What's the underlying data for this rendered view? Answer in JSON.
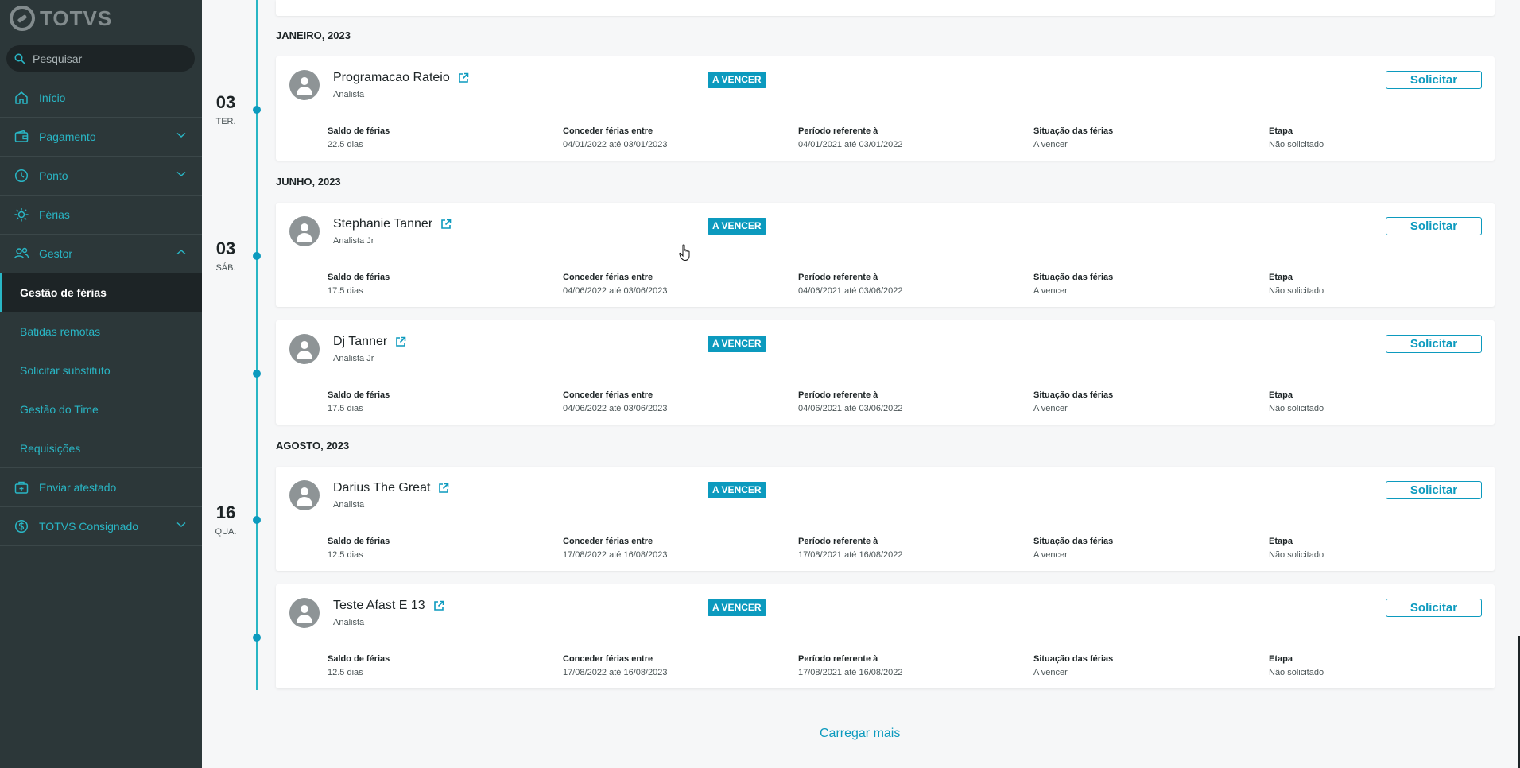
{
  "app": {
    "logo_text": "TOTVS"
  },
  "search": {
    "placeholder": "Pesquisar"
  },
  "sidebar": {
    "items": [
      {
        "label": "Início",
        "icon": "home-icon"
      },
      {
        "label": "Pagamento",
        "icon": "wallet-icon",
        "chevron": "down"
      },
      {
        "label": "Ponto",
        "icon": "clock-icon",
        "chevron": "down"
      },
      {
        "label": "Férias",
        "icon": "sun-icon"
      },
      {
        "label": "Gestor",
        "icon": "users-icon",
        "chevron": "up"
      },
      {
        "label": "Gestão de férias",
        "sub": true,
        "active": true
      },
      {
        "label": "Batidas remotas",
        "sub": true
      },
      {
        "label": "Solicitar substituto",
        "sub": true
      },
      {
        "label": "Gestão do Time",
        "sub": true
      },
      {
        "label": "Requisições",
        "sub": true
      },
      {
        "label": "Enviar atestado",
        "icon": "medical-bag-icon"
      },
      {
        "label": "TOTVS Consignado",
        "icon": "dollar-icon",
        "chevron": "down"
      }
    ]
  },
  "field_labels": {
    "saldo": "Saldo de férias",
    "conceder": "Conceder férias entre",
    "periodo": "Período referente à",
    "situacao": "Situação das férias",
    "etapa": "Etapa"
  },
  "timeline": {
    "months": [
      {
        "label": "JANEIRO, 2023"
      },
      {
        "label": "JUNHO, 2023"
      },
      {
        "label": "AGOSTO, 2023"
      }
    ],
    "dates": [
      {
        "day": "03",
        "weekday": "TER."
      },
      {
        "day": "03",
        "weekday": "SÁB."
      },
      {
        "day": "16",
        "weekday": "QUA."
      }
    ],
    "cards": [
      {
        "name": "Programacao Rateio",
        "role": "Analista",
        "badge": "A VENCER",
        "button": "Solicitar",
        "saldo": "22.5 dias",
        "conceder": "04/01/2022 até 03/01/2023",
        "periodo": "04/01/2021 até 03/01/2022",
        "situacao": "A vencer",
        "etapa": "Não solicitado"
      },
      {
        "name": "Stephanie Tanner",
        "role": "Analista Jr",
        "badge": "A VENCER",
        "button": "Solicitar",
        "saldo": "17.5 dias",
        "conceder": "04/06/2022 até 03/06/2023",
        "periodo": "04/06/2021 até 03/06/2022",
        "situacao": "A vencer",
        "etapa": "Não solicitado"
      },
      {
        "name": "Dj Tanner",
        "role": "Analista Jr",
        "badge": "A VENCER",
        "button": "Solicitar",
        "saldo": "17.5 dias",
        "conceder": "04/06/2022 até 03/06/2023",
        "periodo": "04/06/2021 até 03/06/2022",
        "situacao": "A vencer",
        "etapa": "Não solicitado"
      },
      {
        "name": "Darius The Great",
        "role": "Analista",
        "badge": "A VENCER",
        "button": "Solicitar",
        "saldo": "12.5 dias",
        "conceder": "17/08/2022 até 16/08/2023",
        "periodo": "17/08/2021 até 16/08/2022",
        "situacao": "A vencer",
        "etapa": "Não solicitado"
      },
      {
        "name": "Teste Afast E 13",
        "role": "Analista",
        "badge": "A VENCER",
        "button": "Solicitar",
        "saldo": "12.5 dias",
        "conceder": "17/08/2022 até 16/08/2023",
        "periodo": "17/08/2021 até 16/08/2022",
        "situacao": "A vencer",
        "etapa": "Não solicitado"
      }
    ]
  },
  "load_more": "Carregar mais",
  "colors": {
    "sidebar_bg": "#2c3739",
    "accent": "#29b6c5",
    "primary": "#0c9abe",
    "page_bg": "#f6f7f8"
  }
}
